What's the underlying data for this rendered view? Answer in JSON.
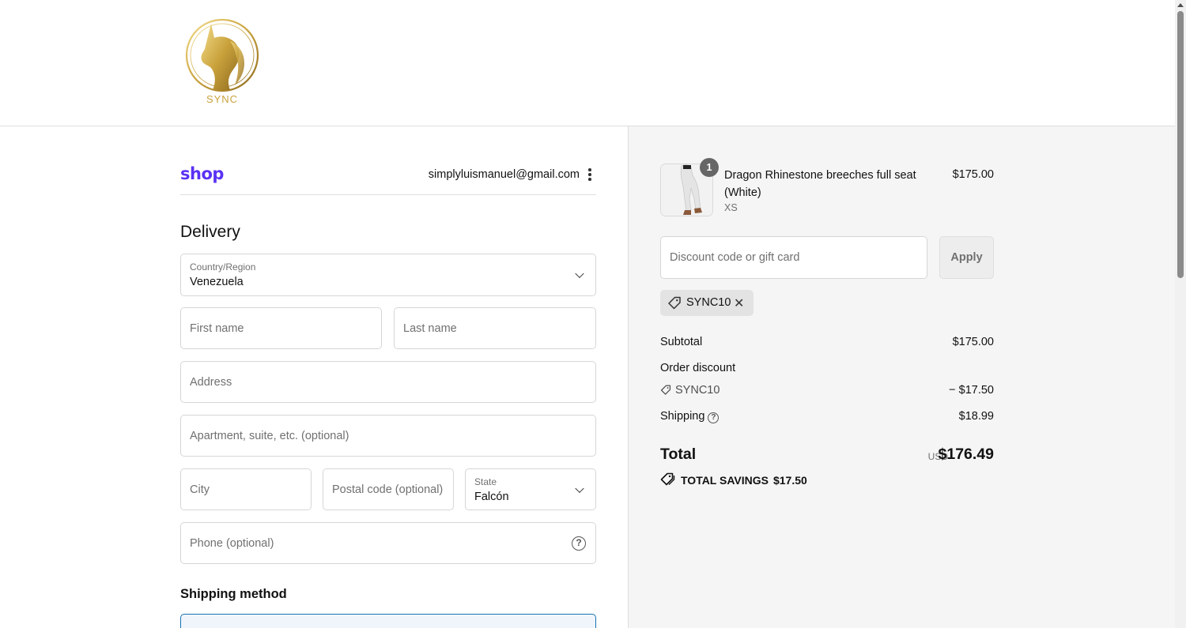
{
  "header": {
    "logo_text": "SYNC",
    "logo_icon": "unicorn-crest-icon"
  },
  "shop": {
    "brand": "shop",
    "email": "simplyluismanuel@gmail.com",
    "menu_icon": "kebab-menu-icon"
  },
  "delivery": {
    "title": "Delivery",
    "country": {
      "label": "Country/Region",
      "value": "Venezuela"
    },
    "first_name": {
      "placeholder": "First name"
    },
    "last_name": {
      "placeholder": "Last name"
    },
    "address": {
      "placeholder": "Address"
    },
    "apartment": {
      "placeholder": "Apartment, suite, etc. (optional)"
    },
    "city": {
      "placeholder": "City"
    },
    "postal": {
      "placeholder": "Postal code (optional)"
    },
    "state": {
      "label": "State",
      "value": "Falcón"
    },
    "phone": {
      "placeholder": "Phone (optional)",
      "help": "?"
    }
  },
  "shipping": {
    "title": "Shipping method"
  },
  "summary": {
    "item": {
      "name": "Dragon Rhinestone breeches full seat (White)",
      "variant": "XS",
      "price": "$175.00",
      "quantity": "1"
    },
    "discount_field": {
      "placeholder": "Discount code or gift card"
    },
    "apply_label": "Apply",
    "applied_code": "SYNC10",
    "subtotal_label": "Subtotal",
    "subtotal_value": "$175.00",
    "order_discount_label": "Order discount",
    "discount_code": "SYNC10",
    "discount_value": "− $17.50",
    "shipping_label": "Shipping",
    "shipping_value": "$18.99",
    "total_label": "Total",
    "currency": "USD",
    "total_value": "$176.49",
    "savings_label": "TOTAL SAVINGS",
    "savings_value": "$17.50"
  },
  "colors": {
    "shop_brand": "#5a31f4",
    "logo_gold": "#c9a23c",
    "focus_blue": "#1773b0",
    "summary_bg": "#f5f5f5"
  }
}
